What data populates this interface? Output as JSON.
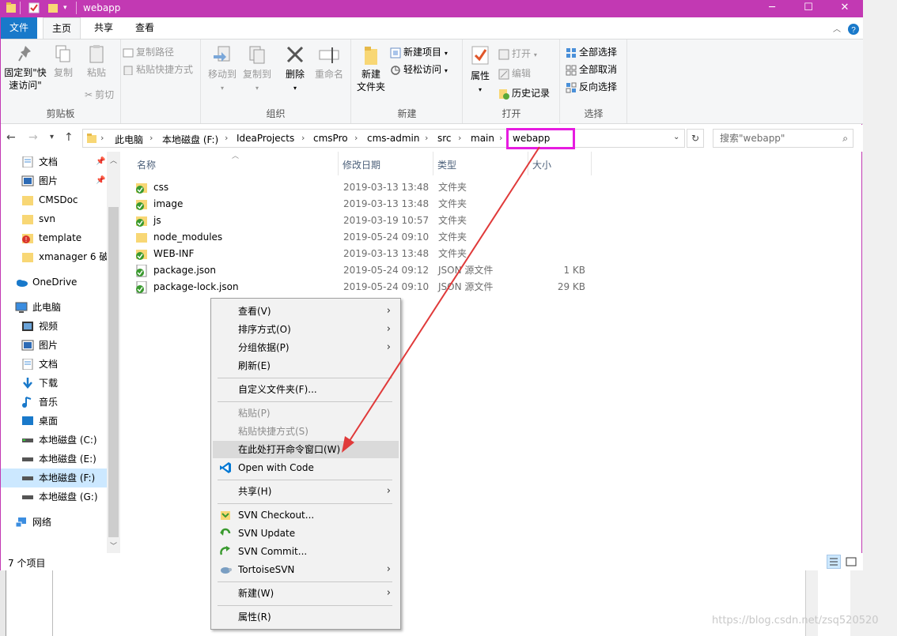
{
  "window": {
    "title": "webapp",
    "accent": "#c239b3"
  },
  "titlebar": {
    "minimize_icon": "─",
    "maximize_icon": "☐",
    "close_icon": "✕"
  },
  "tabs": {
    "file": "文件",
    "home": "主页",
    "share": "共享",
    "view": "查看"
  },
  "ribbon": {
    "clipboard": {
      "label": "剪贴板",
      "pin": "固定到\"快\n速访问\"",
      "copy": "复制",
      "paste": "粘贴",
      "copy_path": "复制路径",
      "paste_shortcut": "粘贴快捷方式",
      "cut": "剪切"
    },
    "organize": {
      "label": "组织",
      "move_to": "移动到",
      "copy_to": "复制到",
      "delete": "删除",
      "rename": "重命名"
    },
    "new": {
      "label": "新建",
      "new_folder": "新建\n文件夹",
      "new_item": "新建项目",
      "easy_access": "轻松访问"
    },
    "open": {
      "label": "打开",
      "properties": "属性",
      "open": "打开",
      "edit": "编辑",
      "history": "历史记录"
    },
    "select": {
      "label": "选择",
      "select_all": "全部选择",
      "select_none": "全部取消",
      "invert": "反向选择"
    }
  },
  "address": {
    "crumbs": [
      "此电脑",
      "本地磁盘 (F:)",
      "IdeaProjects",
      "cmsPro",
      "cms-admin",
      "src",
      "main",
      "webapp"
    ],
    "search_placeholder": "搜索\"webapp\""
  },
  "navpane": {
    "items": [
      {
        "label": "文档",
        "icon": "document-icon",
        "pinned": true
      },
      {
        "label": "图片",
        "icon": "picture-icon",
        "pinned": true
      },
      {
        "label": "CMSDoc",
        "icon": "folder-icon"
      },
      {
        "label": "svn",
        "icon": "folder-icon"
      },
      {
        "label": "template",
        "icon": "svn-conflict-folder-icon"
      },
      {
        "label": "xmanager 6 破",
        "icon": "folder-icon"
      },
      {
        "label": "OneDrive",
        "icon": "onedrive-icon"
      },
      {
        "label": "此电脑",
        "icon": "computer-icon"
      },
      {
        "label": "视频",
        "icon": "video-icon"
      },
      {
        "label": "图片",
        "icon": "picture-icon"
      },
      {
        "label": "文档",
        "icon": "document-icon"
      },
      {
        "label": "下载",
        "icon": "download-icon"
      },
      {
        "label": "音乐",
        "icon": "music-icon"
      },
      {
        "label": "桌面",
        "icon": "desktop-icon"
      },
      {
        "label": "本地磁盘 (C:)",
        "icon": "drive-icon"
      },
      {
        "label": "本地磁盘 (E:)",
        "icon": "drive-icon"
      },
      {
        "label": "本地磁盘 (F:)",
        "icon": "drive-icon",
        "selected": true
      },
      {
        "label": "本地磁盘 (G:)",
        "icon": "drive-icon"
      },
      {
        "label": "网络",
        "icon": "network-icon"
      }
    ]
  },
  "columns": {
    "name": "名称",
    "date": "修改日期",
    "type": "类型",
    "size": "大小"
  },
  "files": [
    {
      "name": "css",
      "date": "2019-03-13 13:48",
      "type": "文件夹",
      "size": "",
      "icon": "svn-folder-icon"
    },
    {
      "name": "image",
      "date": "2019-03-13 13:48",
      "type": "文件夹",
      "size": "",
      "icon": "svn-folder-icon"
    },
    {
      "name": "js",
      "date": "2019-03-19 10:57",
      "type": "文件夹",
      "size": "",
      "icon": "svn-folder-icon"
    },
    {
      "name": "node_modules",
      "date": "2019-05-24 09:10",
      "type": "文件夹",
      "size": "",
      "icon": "folder-icon"
    },
    {
      "name": "WEB-INF",
      "date": "2019-03-13 13:48",
      "type": "文件夹",
      "size": "",
      "icon": "svn-folder-icon"
    },
    {
      "name": "package.json",
      "date": "2019-05-24 09:12",
      "type": "JSON 源文件",
      "size": "1 KB",
      "icon": "svn-file-icon"
    },
    {
      "name": "package-lock.json",
      "date": "2019-05-24 09:10",
      "type": "JSON 源文件",
      "size": "29 KB",
      "icon": "svn-file-icon"
    }
  ],
  "status": {
    "count": "7 个项目"
  },
  "context_menu": {
    "view": "查看(V)",
    "sort": "排序方式(O)",
    "group": "分组依据(P)",
    "refresh": "刷新(E)",
    "customize": "自定义文件夹(F)...",
    "paste": "粘贴(P)",
    "paste_shortcut": "粘贴快捷方式(S)",
    "open_cmd": "在此处打开命令窗口(W)",
    "open_code": "Open with Code",
    "share": "共享(H)",
    "svn_checkout": "SVN Checkout...",
    "svn_update": "SVN Update",
    "svn_commit": "SVN Commit...",
    "tortoise": "TortoiseSVN",
    "new": "新建(W)",
    "properties": "属性(R)"
  },
  "watermark": "https://blog.csdn.net/zsq520520"
}
